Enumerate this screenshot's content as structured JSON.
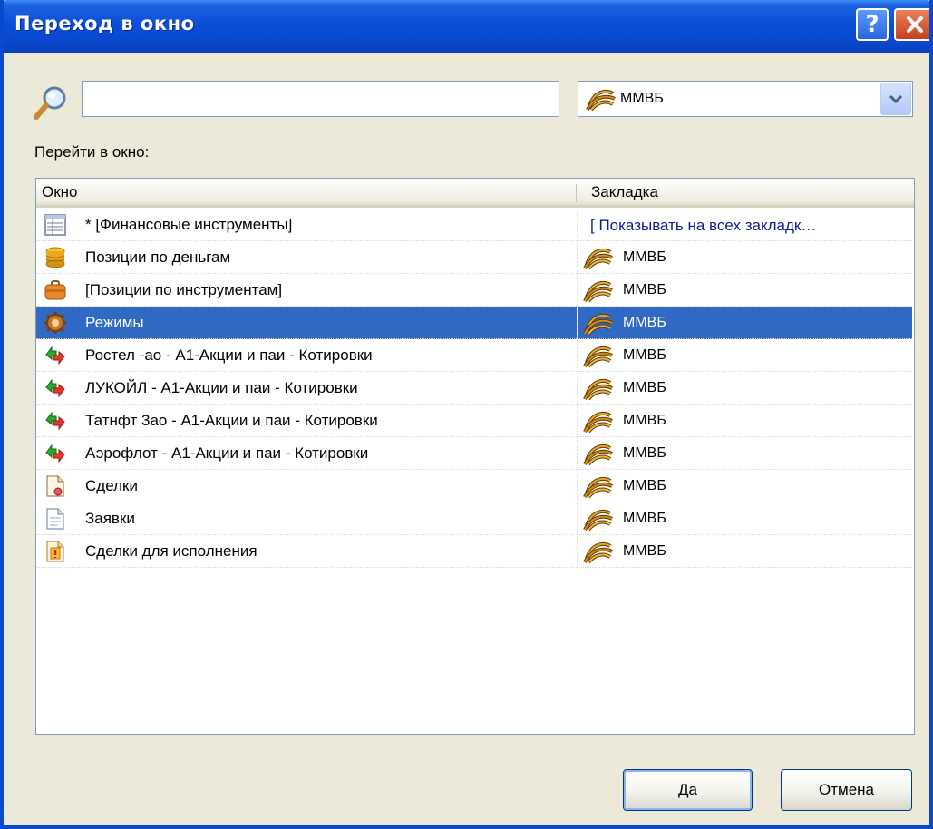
{
  "window": {
    "title": "Переход в окно"
  },
  "search": {
    "value": "",
    "placeholder": ""
  },
  "tab_selector": {
    "selected": "ММВБ"
  },
  "list": {
    "label": "Перейти в окно:",
    "columns": [
      "Окно",
      "Закладка"
    ],
    "rows": [
      {
        "icon": "table-icon",
        "window": "* [Финансовые инструменты]",
        "tab": "[ Показывать на всех закладк…",
        "tab_icon": "none"
      },
      {
        "icon": "coins-icon",
        "window": "Позиции по деньгам",
        "tab": "ММВБ",
        "tab_icon": "micex-icon"
      },
      {
        "icon": "briefcase-icon",
        "window": "[Позиции по инструментам]",
        "tab": "ММВБ",
        "tab_icon": "micex-icon"
      },
      {
        "icon": "gear-icon",
        "window": "Режимы",
        "tab": "ММВБ",
        "tab_icon": "micex-icon",
        "selected": true
      },
      {
        "icon": "quotes-arrows-icon",
        "window": "Ростел -ао - А1-Акции и паи - Котировки",
        "tab": "ММВБ",
        "tab_icon": "micex-icon"
      },
      {
        "icon": "quotes-arrows-icon",
        "window": "ЛУКОЙЛ - А1-Акции и паи - Котировки",
        "tab": "ММВБ",
        "tab_icon": "micex-icon"
      },
      {
        "icon": "quotes-arrows-icon",
        "window": "Татнфт 3ао - А1-Акции и паи - Котировки",
        "tab": "ММВБ",
        "tab_icon": "micex-icon"
      },
      {
        "icon": "quotes-arrows-icon",
        "window": "Аэрофлот - А1-Акции и паи - Котировки",
        "tab": "ММВБ",
        "tab_icon": "micex-icon"
      },
      {
        "icon": "deals-document-icon",
        "window": "Сделки",
        "tab": "ММВБ",
        "tab_icon": "micex-icon"
      },
      {
        "icon": "document-icon",
        "window": "Заявки",
        "tab": "ММВБ",
        "tab_icon": "micex-icon"
      },
      {
        "icon": "alert-document-icon",
        "window": "Сделки для исполнения",
        "tab": "ММВБ",
        "tab_icon": "micex-icon"
      }
    ]
  },
  "buttons": {
    "ok": "Да",
    "cancel": "Отмена"
  },
  "colors": {
    "titlebar": "#0A48CE",
    "selection": "#316AC5",
    "dialog_bg": "#ECE9D8",
    "link_text": "#0B1F8A"
  }
}
